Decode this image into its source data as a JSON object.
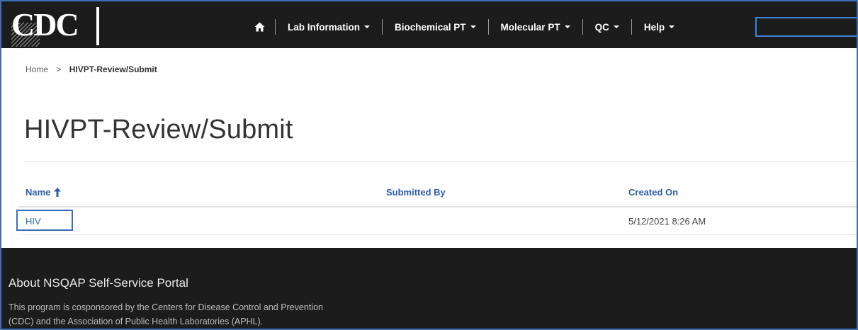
{
  "brand": {
    "logo_text": "CDC",
    "accent": "#3d6fb6",
    "nav_bg": "#1c1c1c"
  },
  "nav": {
    "home_icon": "home-icon",
    "items": [
      {
        "label": "Lab Information"
      },
      {
        "label": "Biochemical PT"
      },
      {
        "label": "Molecular PT"
      },
      {
        "label": "QC"
      },
      {
        "label": "Help"
      }
    ],
    "search": {
      "value": "",
      "placeholder": ""
    }
  },
  "breadcrumb": {
    "home": "Home",
    "separator": ">",
    "current": "HIVPT-Review/Submit"
  },
  "page": {
    "title": "HIVPT-Review/Submit"
  },
  "table": {
    "columns": [
      {
        "label": "Name",
        "sort": "ascending",
        "sort_icon": "arrow-up-icon"
      },
      {
        "label": "Submitted By"
      },
      {
        "label": "Created On"
      }
    ],
    "rows": [
      {
        "name": "HIV",
        "submitted_by": "",
        "created_on": "5/12/2021 8:26 AM"
      }
    ]
  },
  "footer": {
    "title": "About NSQAP Self-Service Portal",
    "text_line1": "This program is cosponsored by the Centers for Disease Control and Prevention",
    "text_line2": "(CDC) and the Association of Public Health Laboratories (APHL)."
  }
}
